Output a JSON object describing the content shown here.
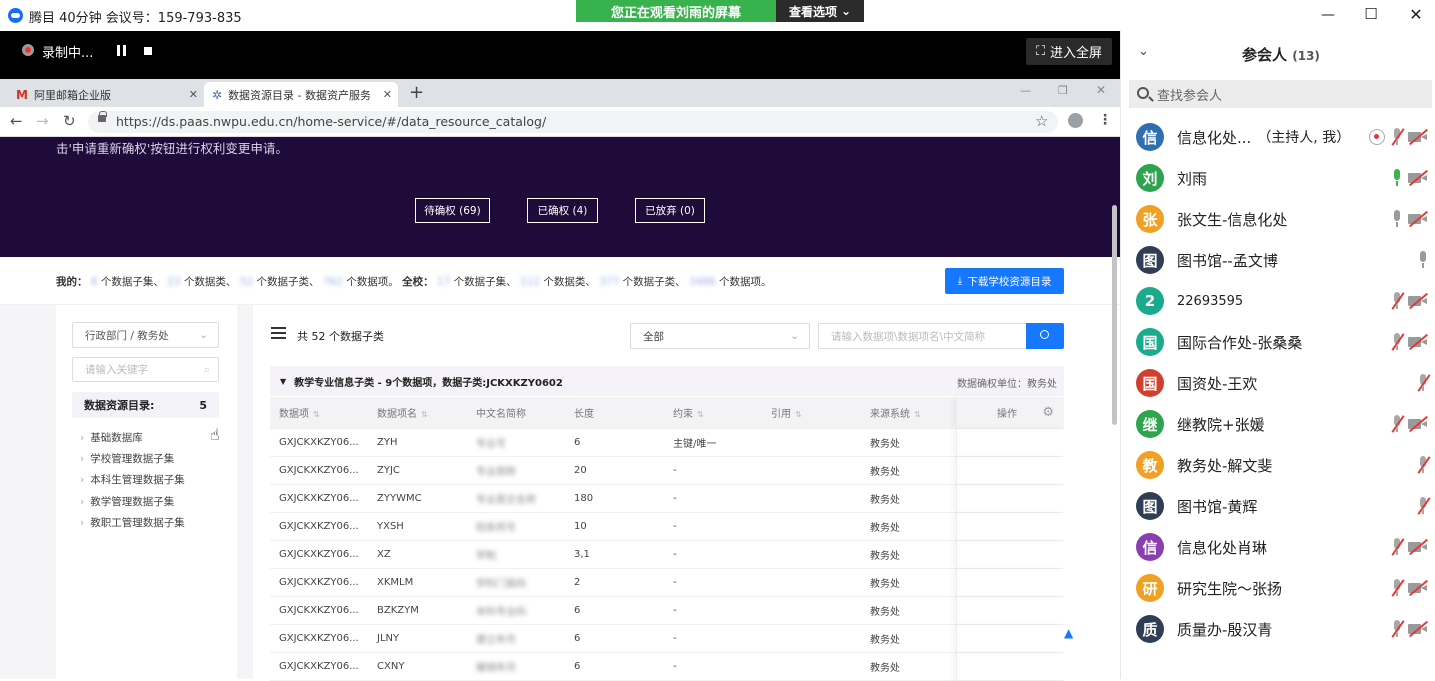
{
  "titlebar": {
    "meeting_info": "腾目 40分钟 会议号：159-793-835",
    "share_banner": "您正在观看刘雨的屏幕",
    "view_options": "查看选项"
  },
  "recording": {
    "label": "录制中...",
    "fullscreen": "进入全屏"
  },
  "browser": {
    "tabs": [
      {
        "title": "阿里邮箱企业版"
      },
      {
        "title": "数据资源目录 - 数据资产服务平台"
      }
    ],
    "url": "https://ds.paas.nwpu.edu.cn/home-service/#/data_resource_catalog/"
  },
  "hero": {
    "text": "击'申请重新确权'按钮进行权利变更申请。",
    "buttons": [
      "待确权 (69)",
      "已确权 (4)",
      "已放弃 (0)"
    ]
  },
  "stats": {
    "mine_label": "我的：",
    "mine_parts": [
      "个数据子集、",
      "个数据类、",
      "个数据子类、",
      "个数据项。"
    ],
    "school_label": "全校：",
    "school_parts": [
      "个数据子集、",
      "个数据类、",
      "个数据子类、",
      "个数据项。"
    ],
    "blurred_values": [
      "8",
      "23",
      "52",
      "762",
      "17",
      "112",
      "377",
      "3486"
    ],
    "download_btn": "下载学校资源目录"
  },
  "sidebar": {
    "dept_select": "行政部门 / 教务处",
    "keyword_placeholder": "请输入关键字",
    "catalog_label": "数据资源目录:",
    "catalog_count": "5",
    "items": [
      "基础数据库",
      "学校管理数据子集",
      "本科生管理数据子集",
      "教学管理数据子集",
      "教职工管理数据子集"
    ]
  },
  "main": {
    "list_title": "共 52 个数据子类",
    "scope_select": "全部",
    "search_placeholder": "请输入数据项\\数据项名\\中文简称",
    "subset_title": "教学专业信息子类 - 9个数据项，数据子类:JCKXKZY0602",
    "subset_unit": "数据确权单位：教务处",
    "columns": [
      "数据项",
      "数据项名",
      "中文名简称",
      "长度",
      "约束",
      "引用",
      "来源系统",
      "操作"
    ],
    "rows": [
      [
        "GXJCKXKZY06...",
        "ZYH",
        "专业号",
        "6",
        "主键/唯一",
        "",
        "教务处"
      ],
      [
        "GXJCKXKZY06...",
        "ZYJC",
        "专业简称",
        "20",
        "-",
        "",
        "教务处"
      ],
      [
        "GXJCKXKZY06...",
        "ZYYWMC",
        "专业英文名称",
        "180",
        "-",
        "",
        "教务处"
      ],
      [
        "GXJCKXKZY06...",
        "YXSH",
        "院系所号",
        "10",
        "-",
        "",
        "教务处"
      ],
      [
        "GXJCKXKZY06...",
        "XZ",
        "学制",
        "3,1",
        "-",
        "",
        "教务处"
      ],
      [
        "GXJCKXKZY06...",
        "XKMLM",
        "学科门类码",
        "2",
        "-",
        "",
        "教务处"
      ],
      [
        "GXJCKXKZY06...",
        "BZKZYM",
        "本科专业码",
        "6",
        "-",
        "",
        "教务处"
      ],
      [
        "GXJCKXKZY06...",
        "JLNY",
        "建立年月",
        "6",
        "-",
        "",
        "教务处"
      ],
      [
        "GXJCKXKZY06...",
        "CXNY",
        "撤销年月",
        "6",
        "-",
        "",
        "教务处"
      ]
    ]
  },
  "participants": {
    "title": "参会人",
    "count": "(13)",
    "search_placeholder": "查找参会人",
    "list": [
      {
        "avatar": "信",
        "color": "#2f6fb0",
        "name": "信息化处...",
        "role": "（主持人, 我）",
        "mic": "muted",
        "cam": "off",
        "rec": true
      },
      {
        "avatar": "刘",
        "color": "#2ea44f",
        "name": "刘雨",
        "mic": "on",
        "cam": "off"
      },
      {
        "avatar": "张",
        "color": "#f0a023",
        "name": "张文生-信息化处",
        "mic": "idle",
        "cam": "off"
      },
      {
        "avatar": "图",
        "color": "#2f3e55",
        "name": "图书馆--孟文博",
        "mic": "idle",
        "cam": "none"
      },
      {
        "avatar": "2",
        "color": "#1aaa8c",
        "name": "22693595",
        "mic": "muted",
        "cam": "off"
      },
      {
        "avatar": "国",
        "color": "#1aaa8c",
        "name": "国际合作处-张桑桑",
        "mic": "muted",
        "cam": "off"
      },
      {
        "avatar": "国",
        "color": "#d04030",
        "name": "国资处-王欢",
        "mic": "muted",
        "cam": "none"
      },
      {
        "avatar": "继",
        "color": "#2ea44f",
        "name": "继教院+张媛",
        "mic": "muted",
        "cam": "off"
      },
      {
        "avatar": "教",
        "color": "#f0a023",
        "name": "教务处-解文斐",
        "mic": "muted",
        "cam": "none"
      },
      {
        "avatar": "图",
        "color": "#2f3e55",
        "name": "图书馆-黄辉",
        "mic": "muted",
        "cam": "none"
      },
      {
        "avatar": "信",
        "color": "#8a3fb0",
        "name": "信息化处肖琳",
        "mic": "muted",
        "cam": "off"
      },
      {
        "avatar": "研",
        "color": "#f0a023",
        "name": "研究生院～张扬",
        "mic": "muted",
        "cam": "off"
      },
      {
        "avatar": "质",
        "color": "#2f3e55",
        "name": "质量办-殷汉青",
        "mic": "muted",
        "cam": "off"
      }
    ]
  }
}
